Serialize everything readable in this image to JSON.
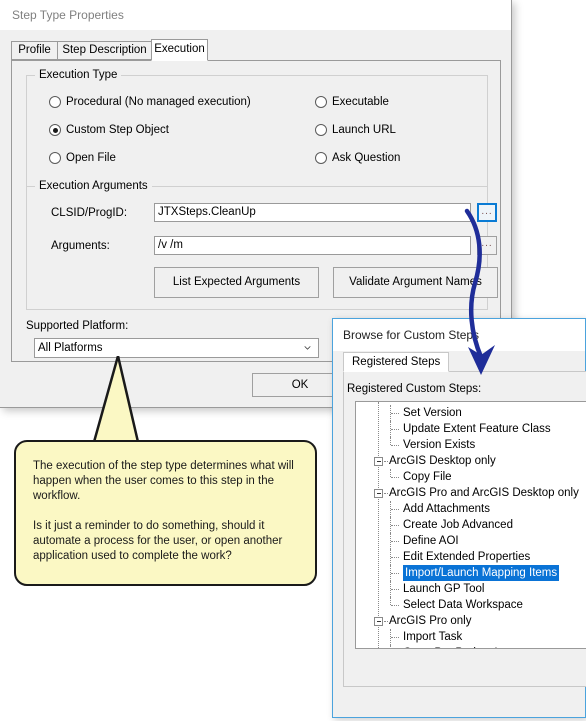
{
  "main_dialog": {
    "title": "Step Type Properties",
    "tabs": [
      {
        "label": "Profile",
        "active": false
      },
      {
        "label": "Step Description",
        "active": false
      },
      {
        "label": "Execution",
        "active": true
      }
    ],
    "execution_type": {
      "group_label": "Execution Type",
      "options_left": [
        {
          "label": "Procedural (No managed execution)",
          "checked": false
        },
        {
          "label": "Custom Step Object",
          "checked": true
        },
        {
          "label": "Open File",
          "checked": false
        }
      ],
      "options_right": [
        {
          "label": "Executable",
          "checked": false
        },
        {
          "label": "Launch URL",
          "checked": false
        },
        {
          "label": "Ask Question",
          "checked": false
        }
      ]
    },
    "execution_arguments": {
      "group_label": "Execution Arguments",
      "clsid_label": "CLSID/ProgID:",
      "clsid_value": "JTXSteps.CleanUp",
      "clsid_browse_label": "...",
      "arguments_label": "Arguments:",
      "arguments_value": "/v /m",
      "arguments_browse_label": "...",
      "list_expected_button": "List Expected Arguments",
      "validate_button": "Validate Argument Names"
    },
    "supported_platform": {
      "label": "Supported Platform:",
      "selected": "All Platforms"
    },
    "ok_button": "OK"
  },
  "browse_dialog": {
    "title": "Browse for Custom Steps",
    "tab_label": "Registered Steps",
    "tree_label": "Registered Custom Steps:",
    "tree_items": [
      {
        "label": "Set Version",
        "depth": 2,
        "node": false,
        "selected": false
      },
      {
        "label": "Update Extent Feature Class",
        "depth": 2,
        "node": false,
        "selected": false
      },
      {
        "label": "Version Exists",
        "depth": 2,
        "node": false,
        "selected": false,
        "last": true
      },
      {
        "label": "ArcGIS Desktop only",
        "depth": 1,
        "node": true,
        "selected": false
      },
      {
        "label": "Copy File",
        "depth": 2,
        "node": false,
        "selected": false,
        "last": true
      },
      {
        "label": "ArcGIS Pro and ArcGIS Desktop only",
        "depth": 1,
        "node": true,
        "selected": false
      },
      {
        "label": "Add Attachments",
        "depth": 2,
        "node": false,
        "selected": false
      },
      {
        "label": "Create Job Advanced",
        "depth": 2,
        "node": false,
        "selected": false
      },
      {
        "label": "Define AOI",
        "depth": 2,
        "node": false,
        "selected": false
      },
      {
        "label": "Edit Extended Properties",
        "depth": 2,
        "node": false,
        "selected": false
      },
      {
        "label": "Import/Launch Mapping Items",
        "depth": 2,
        "node": false,
        "selected": true
      },
      {
        "label": "Launch GP Tool",
        "depth": 2,
        "node": false,
        "selected": false
      },
      {
        "label": "Select Data Workspace",
        "depth": 2,
        "node": false,
        "selected": false,
        "last": true
      },
      {
        "label": "ArcGIS Pro only",
        "depth": 1,
        "node": true,
        "selected": false
      },
      {
        "label": "Import Task",
        "depth": 2,
        "node": false,
        "selected": false
      },
      {
        "label": "Open Pro Project Items",
        "depth": 2,
        "node": false,
        "selected": false,
        "last": true
      }
    ]
  },
  "callout": {
    "text": "The execution of the step type determines what will happen when the user comes to this step in the workflow.\n\nIs it just a reminder to do something, should it automate a process for the user, or open another application used to complete the work?"
  },
  "colors": {
    "selection_blue": "#0a73d6",
    "arrow_blue": "#1f2d99",
    "callout_yellow": "#fbf8c4",
    "dialog_gray": "#f0f0f0",
    "focus_blue": "#0a7bd4"
  }
}
